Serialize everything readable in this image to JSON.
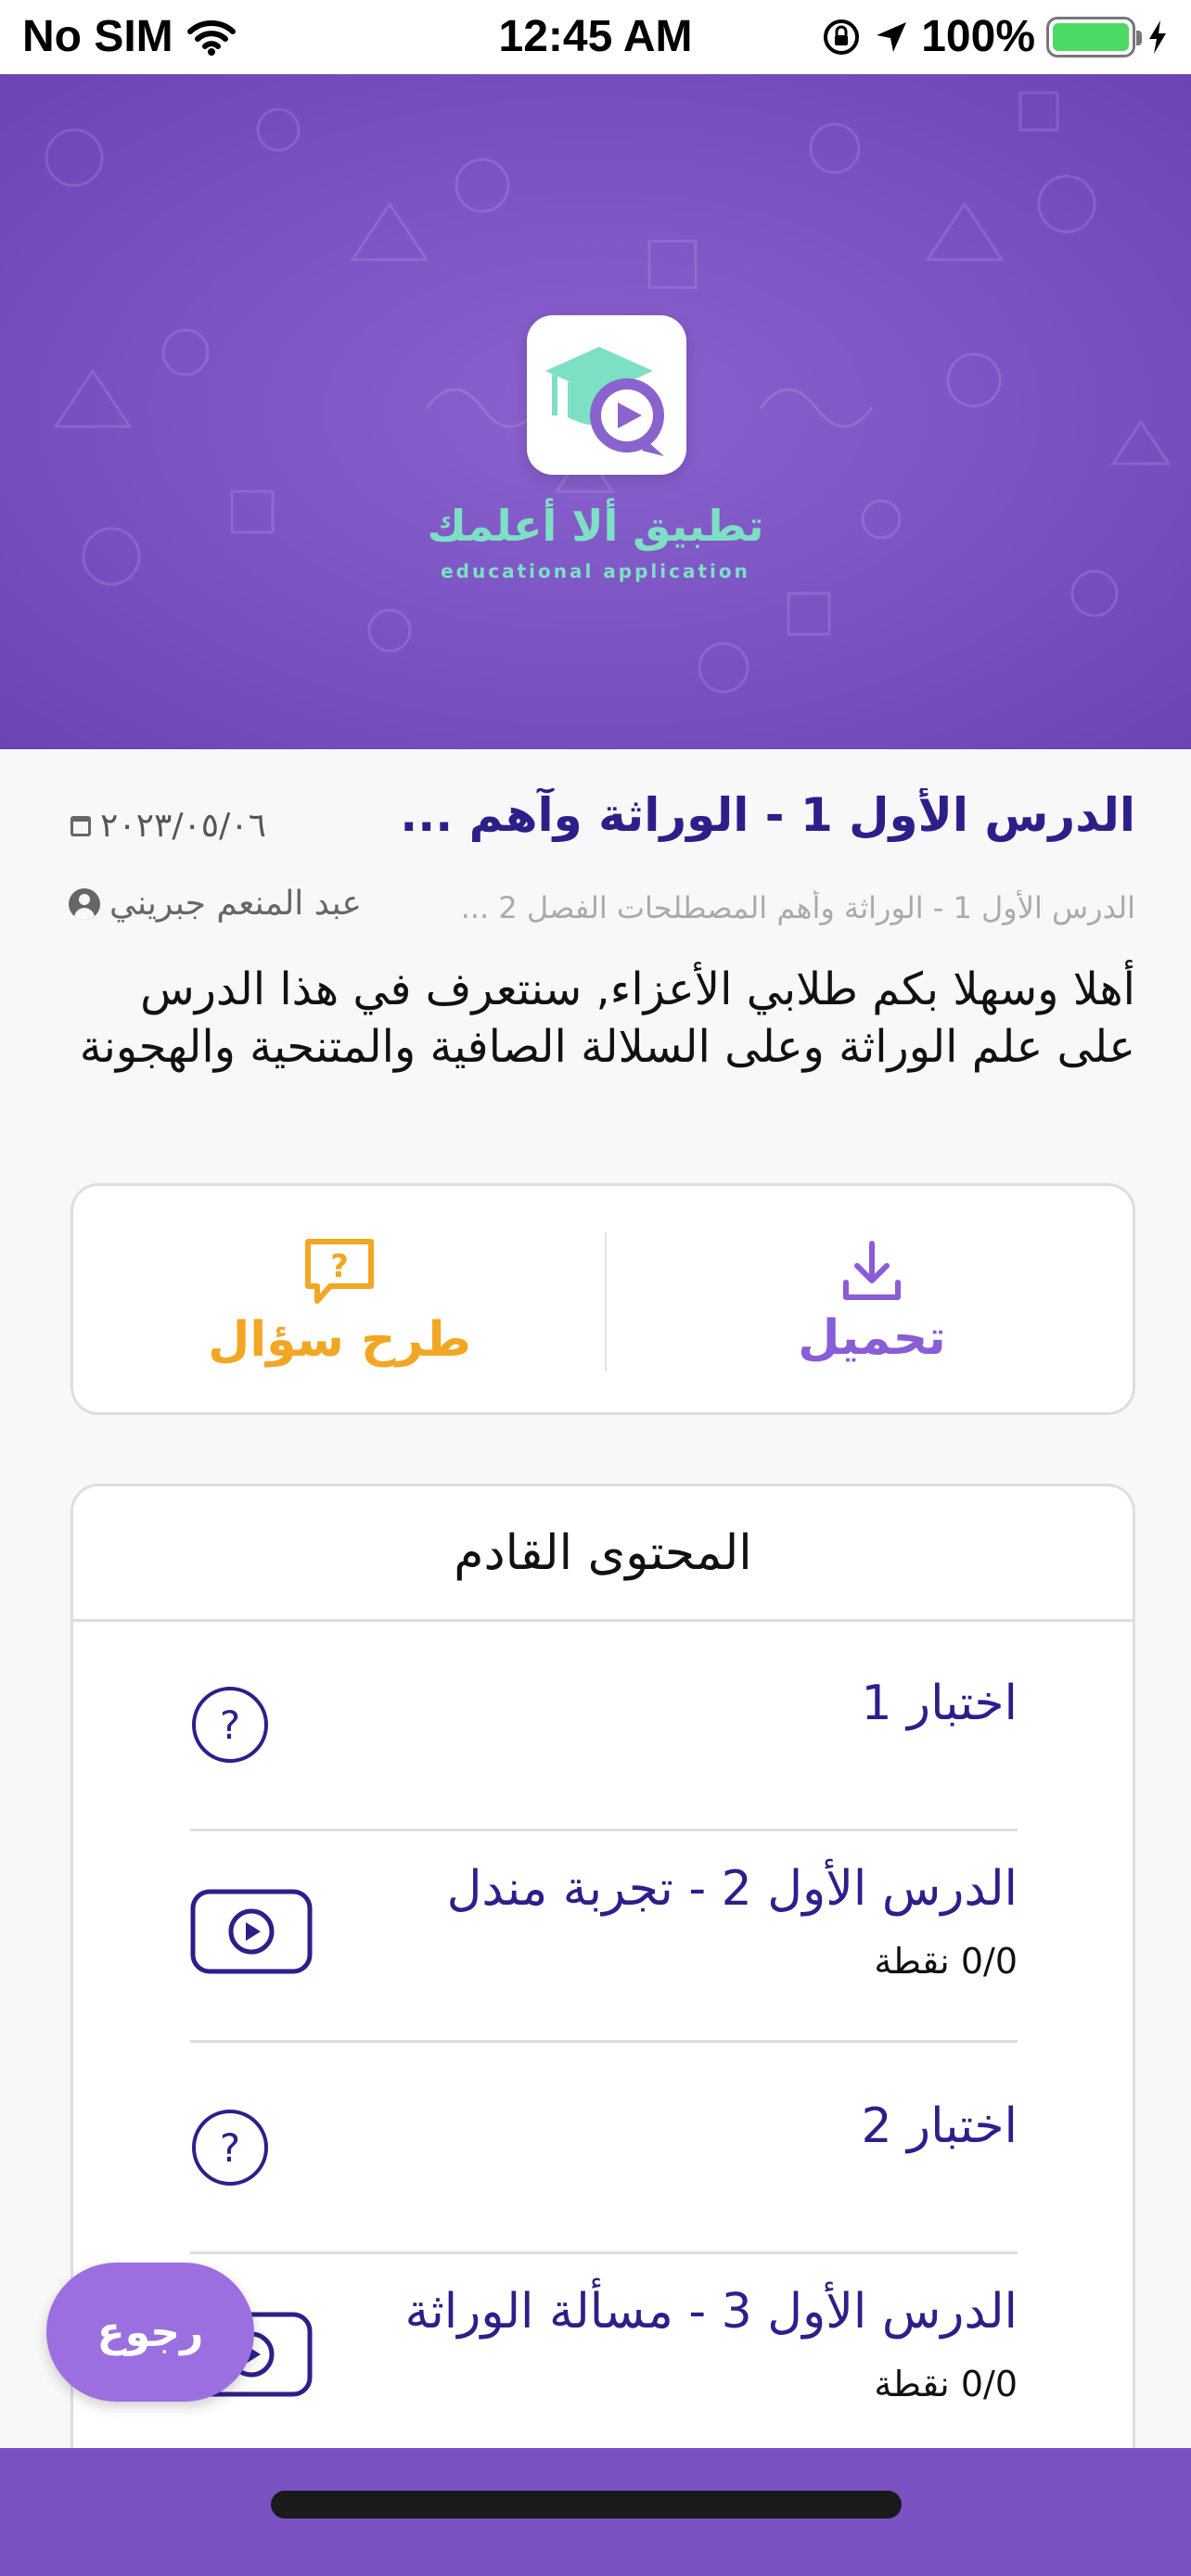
{
  "status_bar": {
    "carrier": "No SIM",
    "time": "12:45 AM",
    "battery": "100%"
  },
  "banner": {
    "app_name": "تطبيق ألا أعلمك",
    "app_tagline": "educational application"
  },
  "lesson": {
    "title": "الدرس الأول 1 - الوراثة وآهم ...",
    "date": "٢٠٢٣/٠٥/٠٦",
    "subtitle": "الدرس الأول 1 - الوراثة وأهم المصطلحات الفصل 2 ...",
    "author": "عبد المنعم جبريني",
    "description": "أهلا وسهلا بكم طلابي الأعزاء, سنتعرف في هذا الدرس على علم الوراثة وعلى السلالة الصافية والمتنحية والهجونة"
  },
  "actions": {
    "download_label": "تحميل",
    "ask_label": "طرح سؤال"
  },
  "upcoming": {
    "heading": "المحتوى القادم",
    "items": [
      {
        "type": "quiz",
        "title": "اختبار 1",
        "points": ""
      },
      {
        "type": "video",
        "title": "الدرس الأول 2 - تجربة مندل",
        "points": "0/0 نقطة"
      },
      {
        "type": "quiz",
        "title": "اختبار 2",
        "points": ""
      },
      {
        "type": "video",
        "title": "الدرس الأول 3 - مسألة الوراثة",
        "points": "0/0 نقطة"
      }
    ]
  },
  "back_button": "رجوع",
  "colors": {
    "brand_purple": "#7a52c2",
    "title_navy": "#2d1f8a",
    "accent_orange": "#f3a623",
    "accent_violet": "#8a5cd6",
    "logo_mint": "#7de0c4"
  }
}
